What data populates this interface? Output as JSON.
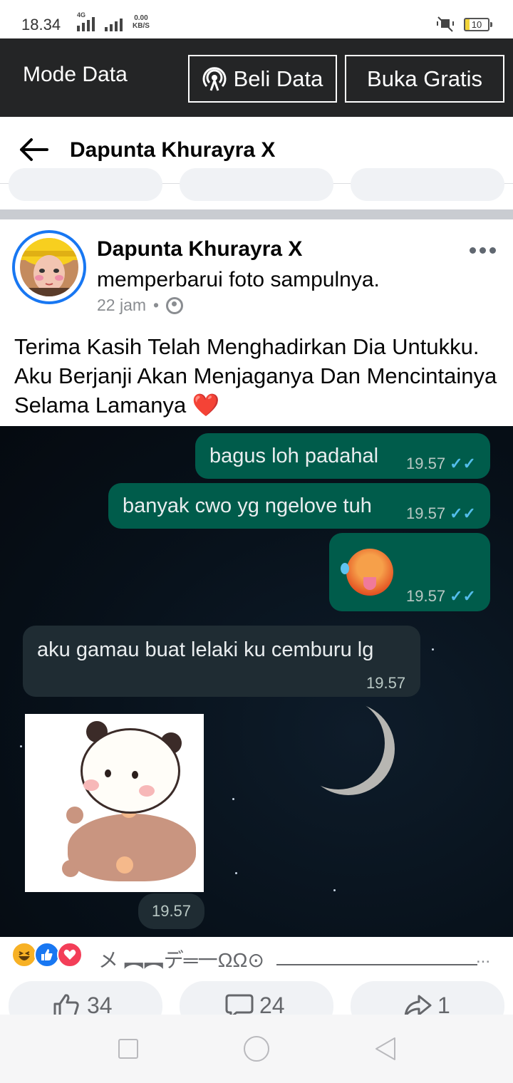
{
  "status_bar": {
    "time": "18.34",
    "network": "4G",
    "speed_value": "0.00",
    "speed_unit": "KB/S",
    "battery": "10"
  },
  "data_banner": {
    "title": "Mode Data",
    "buy_label": "Beli Data",
    "free_label": "Buka Gratis"
  },
  "header": {
    "title": "Dapunta Khurayra X"
  },
  "post": {
    "author": "Dapunta Khurayra X",
    "action": "memperbarui foto sampulnya.",
    "time": "22 jam",
    "separator": "•",
    "text": "Terima Kasih Telah Menghadirkan Dia Untukku. Aku Berjanji Akan Menjaganya Dan Mencintainya Selama Lamanya",
    "text_emoji": "❤️"
  },
  "chat": {
    "messages": [
      {
        "text": "bagus loh padahal",
        "time": "19.57",
        "ticks": "✓✓"
      },
      {
        "text": "banyak cwo yg ngelove tuh",
        "time": "19.57",
        "ticks": "✓✓"
      },
      {
        "text": "",
        "time": "19.57",
        "ticks": "✓✓"
      },
      {
        "text": "aku gamau buat lelaki ku cemburu lg",
        "time": "19.57"
      }
    ],
    "sticker_time": "19.57"
  },
  "reactions": {
    "icons": [
      "haha-icon",
      "like-icon",
      "love-icon"
    ],
    "names": "メ ︻︻デ═一ΩΩ⊙"
  },
  "actions": {
    "like_count": "34",
    "comment_count": "24",
    "share_count": "1"
  },
  "colors": {
    "facebook_blue": "#1877f2",
    "banner_bg": "#242526",
    "outgoing_bubble": "#005c4b",
    "incoming_bubble": "#1f2c33",
    "read_ticks": "#53bdeb"
  }
}
